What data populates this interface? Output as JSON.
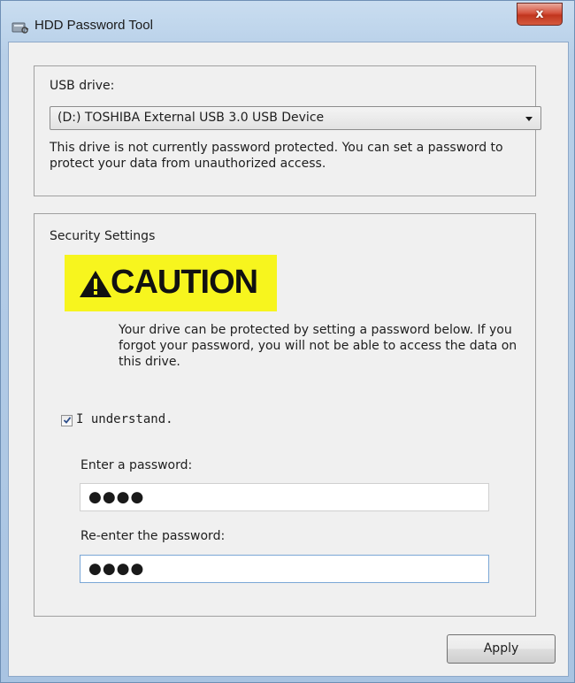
{
  "window": {
    "title": "HDD Password Tool",
    "close_label": "x"
  },
  "usb": {
    "label": "USB drive:",
    "selected_drive": "(D:) TOSHIBA External USB 3.0 USB Device",
    "info_text": "This drive is not currently password protected. You can set a password to protect your data from unauthorized access."
  },
  "security": {
    "heading": "Security Settings",
    "caution_label": "CAUTION",
    "warning_text": "Your drive can be protected by setting a password below. If you forgot your password, you will not be able to access the data on this drive.",
    "understand_label": "I understand.",
    "understand_checked": true,
    "password_label": "Enter a password:",
    "password_value": "●●●●",
    "reenter_label": "Re-enter the password:",
    "reenter_value": "●●●●"
  },
  "footer": {
    "apply_label": "Apply"
  },
  "colors": {
    "caution_background": "#f7f51e",
    "close_button": "#c9452e",
    "title_bar": "#b7cfe8"
  }
}
